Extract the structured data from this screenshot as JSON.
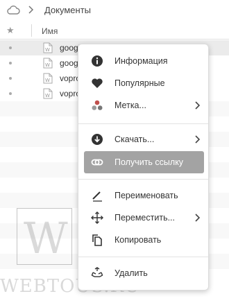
{
  "breadcrumb": {
    "icon": "cloud-icon",
    "separator": "chevron-right-icon",
    "label": "Документы"
  },
  "header": {
    "star_label": "★",
    "name_label": "Имя"
  },
  "files": [
    {
      "name": "googl",
      "icon": "word-doc-icon",
      "state": "selected"
    },
    {
      "name": "googl",
      "icon": "word-doc-icon",
      "state": "normal"
    },
    {
      "name": "vopro",
      "icon": "word-doc-icon",
      "state": "normal"
    },
    {
      "name": "vopro",
      "icon": "word-doc-icon",
      "state": "normal"
    }
  ],
  "context_menu": {
    "items": [
      {
        "label": "Информация",
        "icon": "info-icon",
        "submenu": false
      },
      {
        "label": "Популярные",
        "icon": "heart-icon",
        "submenu": false
      },
      {
        "label": "Метка...",
        "icon": "tag-dots-icon",
        "submenu": true
      },
      {
        "label": "Скачать...",
        "icon": "download-icon",
        "submenu": true
      },
      {
        "label": "Получить ссылку",
        "icon": "link-icon",
        "submenu": false,
        "active": true
      },
      {
        "label": "Переименовать",
        "icon": "pencil-icon",
        "submenu": false
      },
      {
        "label": "Переместить...",
        "icon": "move-arrows-icon",
        "submenu": true
      },
      {
        "label": "Копировать",
        "icon": "copy-icon",
        "submenu": false
      },
      {
        "label": "Удалить",
        "icon": "recycle-icon",
        "submenu": false
      }
    ]
  },
  "watermark": {
    "letter": "W",
    "text": "WEBTOUS.RU"
  },
  "colors": {
    "active_item_bg": "#a3a3a3",
    "icon_dark": "#333333",
    "tag_dot_red": "#c0504d",
    "selected_row_bg": "#ebebeb"
  }
}
